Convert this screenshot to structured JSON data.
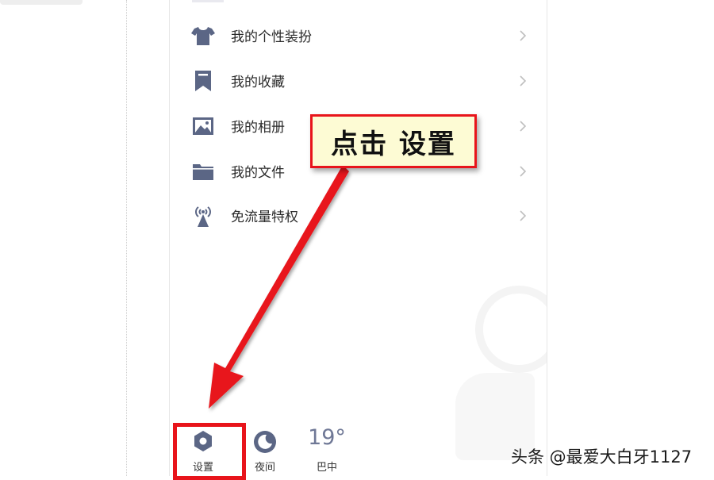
{
  "menu": {
    "items": [
      {
        "label": "我的个性装扮",
        "icon": "tshirt-icon"
      },
      {
        "label": "我的收藏",
        "icon": "bookmark-icon"
      },
      {
        "label": "我的相册",
        "icon": "photo-icon"
      },
      {
        "label": "我的文件",
        "icon": "folder-icon"
      },
      {
        "label": "免流量特权",
        "icon": "signal-tower-icon"
      }
    ]
  },
  "bottom_bar": {
    "settings_label": "设置",
    "night_label": "夜间",
    "weather_temp": "19°",
    "weather_city": "巴中"
  },
  "annotation": {
    "callout_text": "点击 设置",
    "accent_color": "#e8141b"
  },
  "watermark": "头条 @最爱大白牙1127",
  "colors": {
    "icon_color": "#5b6685",
    "callout_bg": "#fdfbd4"
  }
}
